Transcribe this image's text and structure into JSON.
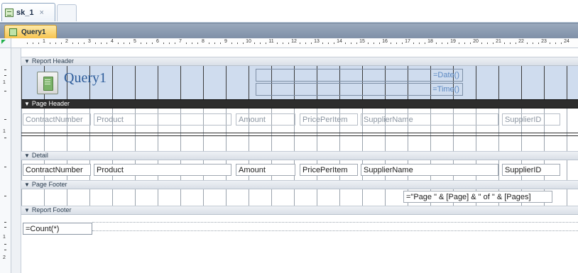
{
  "window": {
    "doc_tab_label": "sk_1",
    "doc_tab_close": "×",
    "object_tab_label": "Query1"
  },
  "ruler": {
    "numbers": [
      "1",
      "2",
      "3",
      "4",
      "5",
      "6",
      "7",
      "8",
      "9",
      "10",
      "11",
      "12",
      "13",
      "14",
      "15",
      "16",
      "17",
      "18",
      "19",
      "20",
      "21",
      "22",
      "23",
      "24"
    ],
    "vertical_marks": [
      "1",
      "1",
      "1",
      "2"
    ]
  },
  "sections": {
    "report_header": "Report Header",
    "page_header": "Page Header",
    "detail": "Detail",
    "page_footer": "Page Footer",
    "report_footer": "Report Footer"
  },
  "report_header": {
    "title": "Query1",
    "date_expr": "=Date()",
    "time_expr": "=Time()"
  },
  "page_header": {
    "labels": [
      "ContractNumber",
      "Product",
      "Amount",
      "PricePerItem",
      "SupplierName",
      "SupplierID"
    ]
  },
  "detail": {
    "fields": [
      "ContractNumber",
      "Product",
      "Amount",
      "PricePerItem",
      "SupplierName",
      "SupplierID"
    ]
  },
  "page_footer": {
    "page_expr": "=\"Page \" & [Page] & \" of \" & [Pages]"
  },
  "report_footer": {
    "count_expr": "=Count(*)"
  },
  "colors": {
    "section_bar": "#dde3ea",
    "selected_section": "#2d2d2d",
    "header_fill": "#cfdcee",
    "accent_title": "#2e5d9b"
  }
}
